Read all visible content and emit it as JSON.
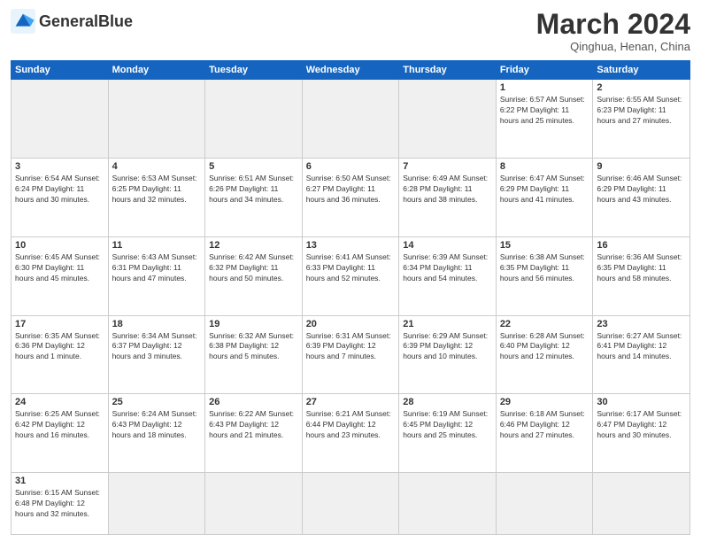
{
  "logo": {
    "text_normal": "General",
    "text_bold": "Blue"
  },
  "header": {
    "month": "March 2024",
    "location": "Qinghua, Henan, China"
  },
  "weekdays": [
    "Sunday",
    "Monday",
    "Tuesday",
    "Wednesday",
    "Thursday",
    "Friday",
    "Saturday"
  ],
  "days": {
    "w1": [
      {
        "num": "",
        "info": ""
      },
      {
        "num": "",
        "info": ""
      },
      {
        "num": "",
        "info": ""
      },
      {
        "num": "",
        "info": ""
      },
      {
        "num": "",
        "info": ""
      },
      {
        "num": "1",
        "info": "Sunrise: 6:57 AM\nSunset: 6:22 PM\nDaylight: 11 hours\nand 25 minutes."
      },
      {
        "num": "2",
        "info": "Sunrise: 6:55 AM\nSunset: 6:23 PM\nDaylight: 11 hours\nand 27 minutes."
      }
    ],
    "w2": [
      {
        "num": "3",
        "info": "Sunrise: 6:54 AM\nSunset: 6:24 PM\nDaylight: 11 hours\nand 30 minutes."
      },
      {
        "num": "4",
        "info": "Sunrise: 6:53 AM\nSunset: 6:25 PM\nDaylight: 11 hours\nand 32 minutes."
      },
      {
        "num": "5",
        "info": "Sunrise: 6:51 AM\nSunset: 6:26 PM\nDaylight: 11 hours\nand 34 minutes."
      },
      {
        "num": "6",
        "info": "Sunrise: 6:50 AM\nSunset: 6:27 PM\nDaylight: 11 hours\nand 36 minutes."
      },
      {
        "num": "7",
        "info": "Sunrise: 6:49 AM\nSunset: 6:28 PM\nDaylight: 11 hours\nand 38 minutes."
      },
      {
        "num": "8",
        "info": "Sunrise: 6:47 AM\nSunset: 6:29 PM\nDaylight: 11 hours\nand 41 minutes."
      },
      {
        "num": "9",
        "info": "Sunrise: 6:46 AM\nSunset: 6:29 PM\nDaylight: 11 hours\nand 43 minutes."
      }
    ],
    "w3": [
      {
        "num": "10",
        "info": "Sunrise: 6:45 AM\nSunset: 6:30 PM\nDaylight: 11 hours\nand 45 minutes."
      },
      {
        "num": "11",
        "info": "Sunrise: 6:43 AM\nSunset: 6:31 PM\nDaylight: 11 hours\nand 47 minutes."
      },
      {
        "num": "12",
        "info": "Sunrise: 6:42 AM\nSunset: 6:32 PM\nDaylight: 11 hours\nand 50 minutes."
      },
      {
        "num": "13",
        "info": "Sunrise: 6:41 AM\nSunset: 6:33 PM\nDaylight: 11 hours\nand 52 minutes."
      },
      {
        "num": "14",
        "info": "Sunrise: 6:39 AM\nSunset: 6:34 PM\nDaylight: 11 hours\nand 54 minutes."
      },
      {
        "num": "15",
        "info": "Sunrise: 6:38 AM\nSunset: 6:35 PM\nDaylight: 11 hours\nand 56 minutes."
      },
      {
        "num": "16",
        "info": "Sunrise: 6:36 AM\nSunset: 6:35 PM\nDaylight: 11 hours\nand 58 minutes."
      }
    ],
    "w4": [
      {
        "num": "17",
        "info": "Sunrise: 6:35 AM\nSunset: 6:36 PM\nDaylight: 12 hours\nand 1 minute."
      },
      {
        "num": "18",
        "info": "Sunrise: 6:34 AM\nSunset: 6:37 PM\nDaylight: 12 hours\nand 3 minutes."
      },
      {
        "num": "19",
        "info": "Sunrise: 6:32 AM\nSunset: 6:38 PM\nDaylight: 12 hours\nand 5 minutes."
      },
      {
        "num": "20",
        "info": "Sunrise: 6:31 AM\nSunset: 6:39 PM\nDaylight: 12 hours\nand 7 minutes."
      },
      {
        "num": "21",
        "info": "Sunrise: 6:29 AM\nSunset: 6:39 PM\nDaylight: 12 hours\nand 10 minutes."
      },
      {
        "num": "22",
        "info": "Sunrise: 6:28 AM\nSunset: 6:40 PM\nDaylight: 12 hours\nand 12 minutes."
      },
      {
        "num": "23",
        "info": "Sunrise: 6:27 AM\nSunset: 6:41 PM\nDaylight: 12 hours\nand 14 minutes."
      }
    ],
    "w5": [
      {
        "num": "24",
        "info": "Sunrise: 6:25 AM\nSunset: 6:42 PM\nDaylight: 12 hours\nand 16 minutes."
      },
      {
        "num": "25",
        "info": "Sunrise: 6:24 AM\nSunset: 6:43 PM\nDaylight: 12 hours\nand 18 minutes."
      },
      {
        "num": "26",
        "info": "Sunrise: 6:22 AM\nSunset: 6:43 PM\nDaylight: 12 hours\nand 21 minutes."
      },
      {
        "num": "27",
        "info": "Sunrise: 6:21 AM\nSunset: 6:44 PM\nDaylight: 12 hours\nand 23 minutes."
      },
      {
        "num": "28",
        "info": "Sunrise: 6:19 AM\nSunset: 6:45 PM\nDaylight: 12 hours\nand 25 minutes."
      },
      {
        "num": "29",
        "info": "Sunrise: 6:18 AM\nSunset: 6:46 PM\nDaylight: 12 hours\nand 27 minutes."
      },
      {
        "num": "30",
        "info": "Sunrise: 6:17 AM\nSunset: 6:47 PM\nDaylight: 12 hours\nand 30 minutes."
      }
    ],
    "w6": [
      {
        "num": "31",
        "info": "Sunrise: 6:15 AM\nSunset: 6:48 PM\nDaylight: 12 hours\nand 32 minutes."
      },
      {
        "num": "",
        "info": ""
      },
      {
        "num": "",
        "info": ""
      },
      {
        "num": "",
        "info": ""
      },
      {
        "num": "",
        "info": ""
      },
      {
        "num": "",
        "info": ""
      },
      {
        "num": "",
        "info": ""
      }
    ]
  }
}
